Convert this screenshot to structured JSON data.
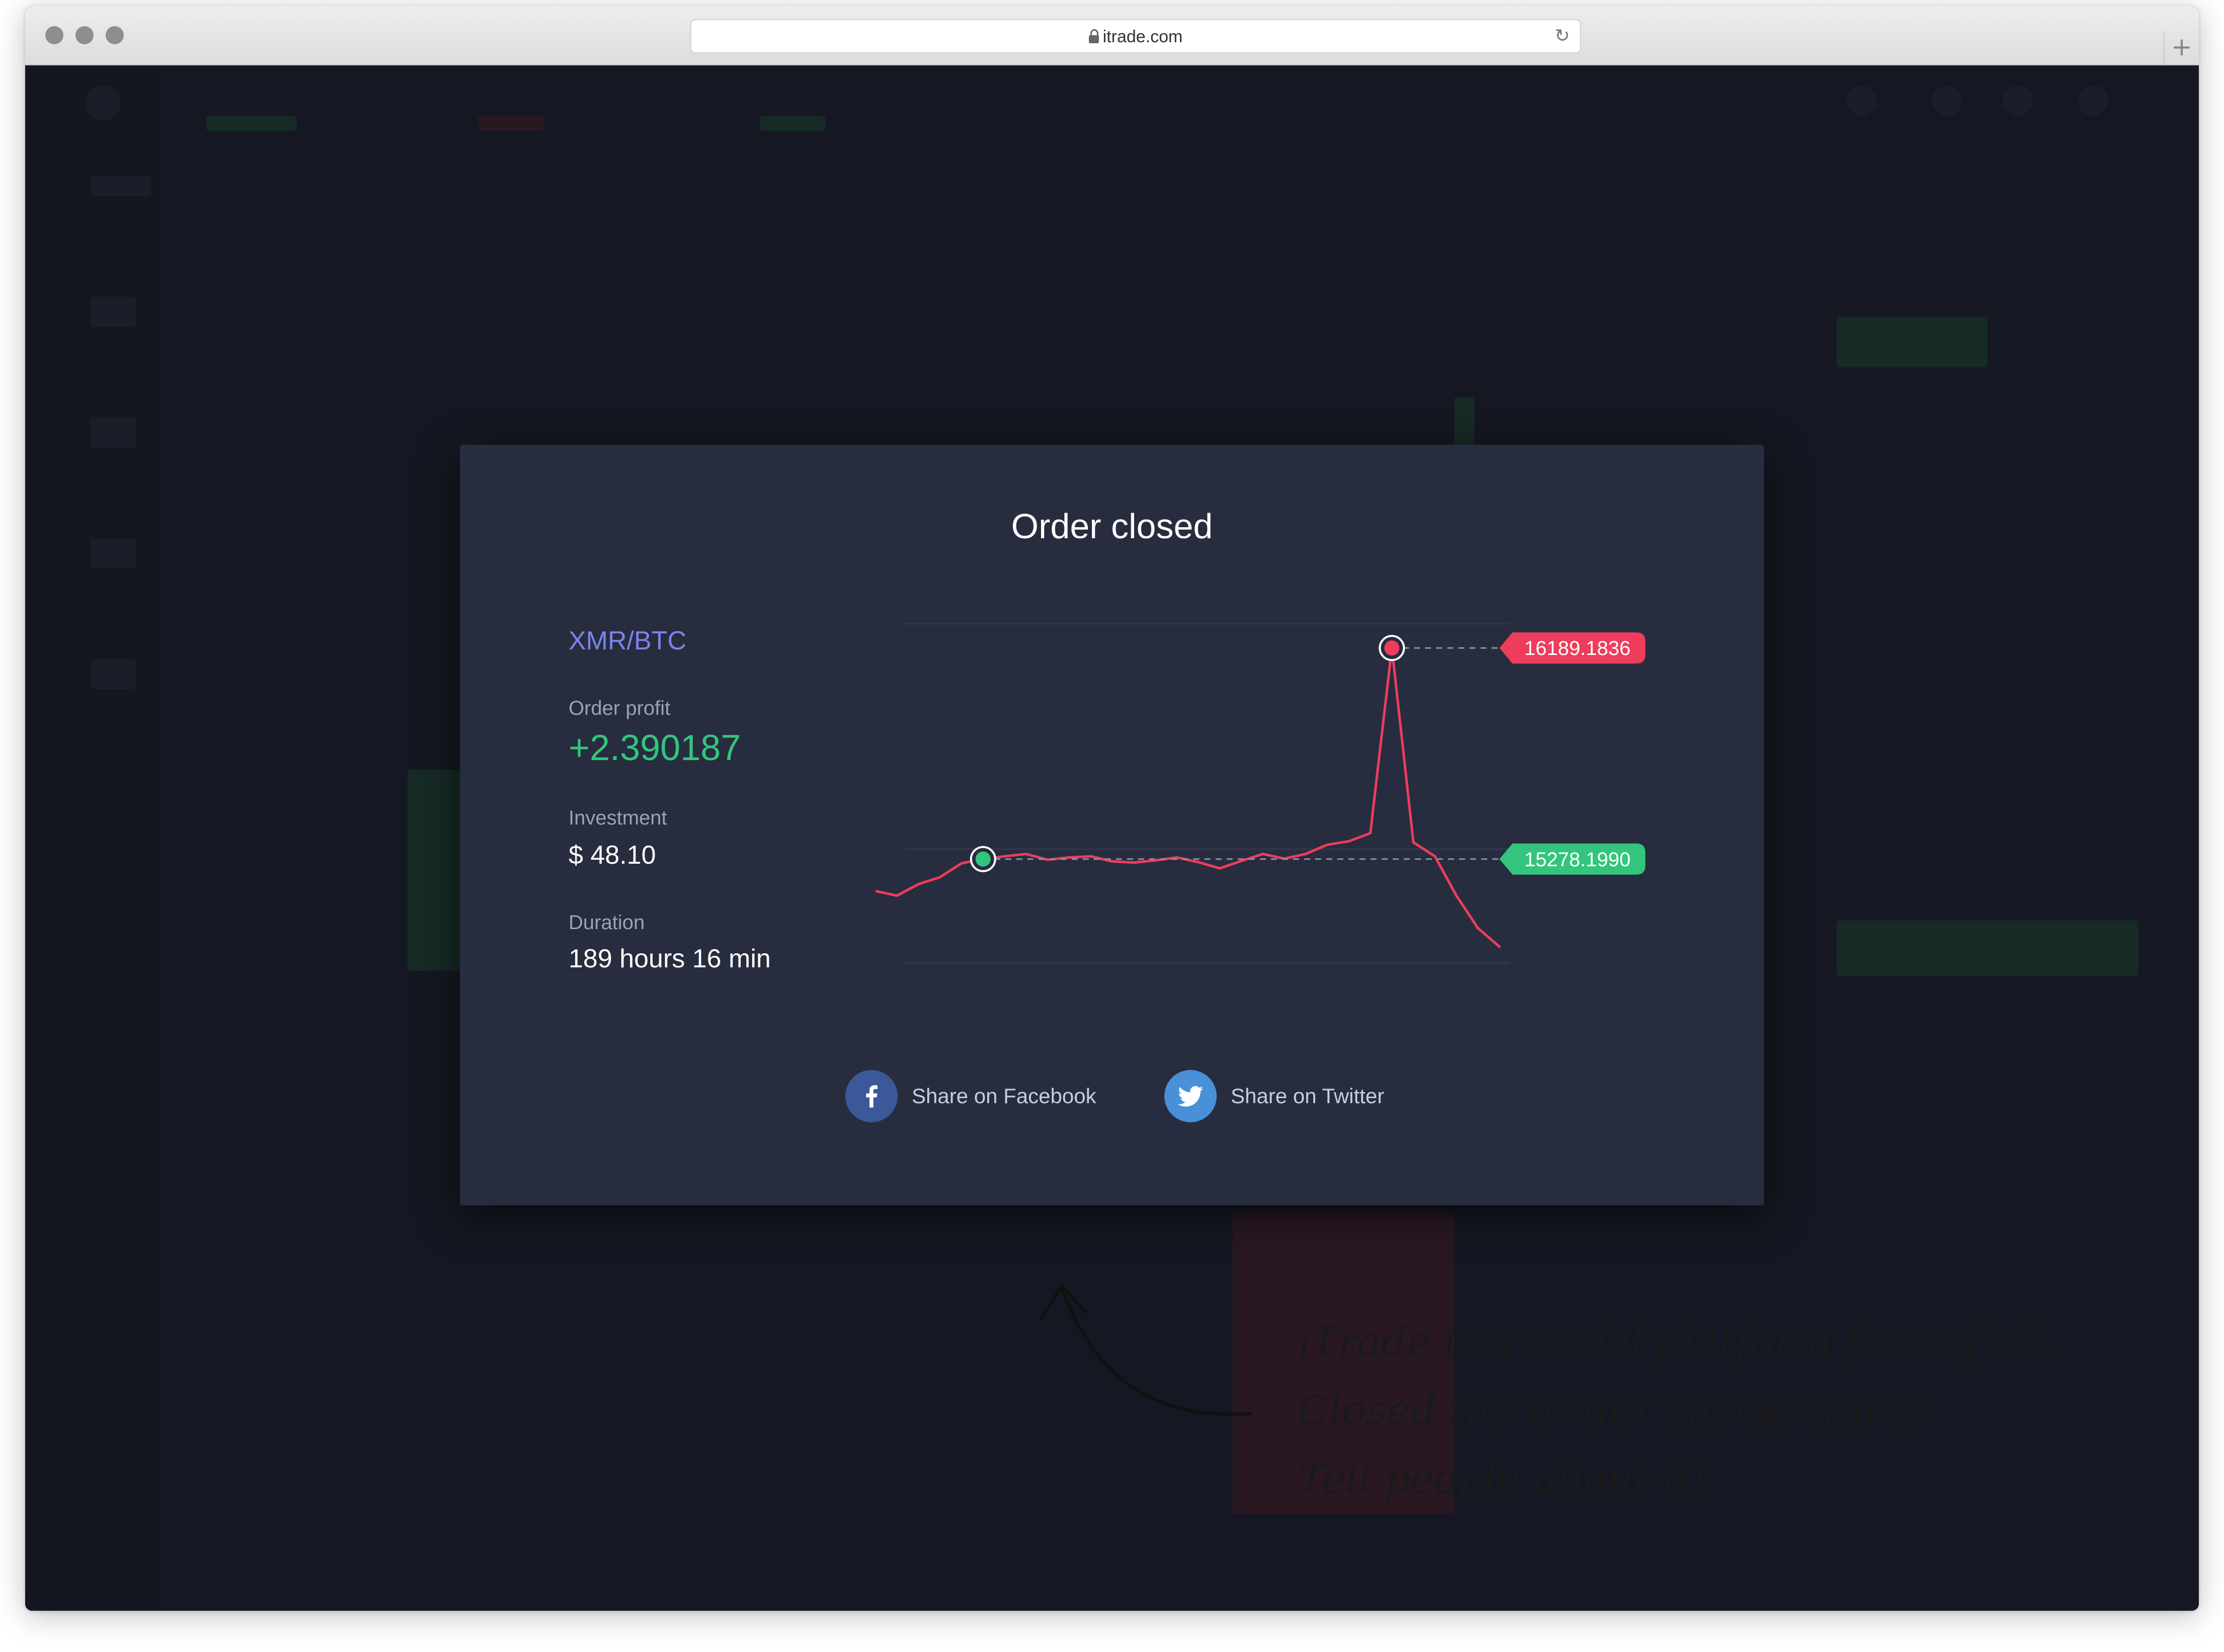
{
  "browser": {
    "url": "itrade.com"
  },
  "modal": {
    "title": "Order closed",
    "pair": "XMR/BTC",
    "profit_label": "Order profit",
    "profit_value": "+2.390187",
    "investment_label": "Investment",
    "investment_value": "$ 48.10",
    "duration_label": "Duration",
    "duration_value": "189 hours 16 min",
    "close_price": "16189.1836",
    "open_price": "15278.1990",
    "share_facebook": "Share on Facebook",
    "share_twitter": "Share on Twitter"
  },
  "colors": {
    "accent_green": "#33c57d",
    "accent_red": "#ee3d5c",
    "pair_blue": "#7b83e8",
    "facebook": "#3b5998",
    "twitter": "#4a90d9"
  },
  "annotation": {
    "line1": "iTrade is a social platform first of all.",
    "line2": "Closed the or der successfully?",
    "line3": "Tell people about it!"
  },
  "chart_data": {
    "type": "line",
    "series": [
      {
        "values": [
          15140,
          15120,
          15170,
          15200,
          15260,
          15278,
          15290,
          15300,
          15275,
          15285,
          15290,
          15268,
          15263,
          15272,
          15285,
          15265,
          15238,
          15270,
          15300,
          15280,
          15300,
          15340,
          15355,
          15390,
          16189,
          15350,
          15290,
          15120,
          14980,
          14900
        ]
      }
    ],
    "markers": [
      {
        "label": "15278.1990",
        "index": 5,
        "color": "#33c57d"
      },
      {
        "label": "16189.1836",
        "index": 24,
        "color": "#ee3d5c"
      }
    ]
  }
}
